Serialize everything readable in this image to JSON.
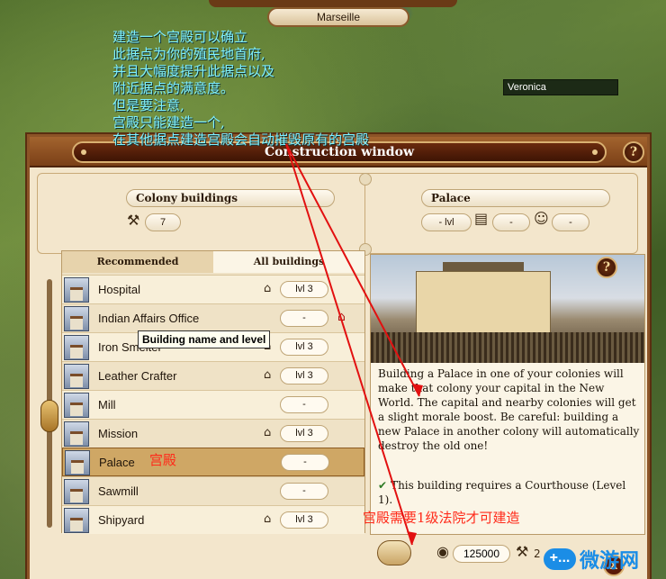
{
  "map": {
    "city_name": "Marseille",
    "player_name": "Veronica"
  },
  "annotations": {
    "note_lines": [
      "建造一个宫殿可以确立",
      "此据点为你的殖民地首府,",
      "并且大幅度提升此据点以及",
      "附近据点的满意度。",
      "但是要注意,",
      "宫殿只能建造一个,",
      "在其他据点建造宫殿会自动摧毁原有的宫殿"
    ],
    "palace_cn": "宫殿",
    "requirement_cn": "宫殿需要1级法院才可建造"
  },
  "window": {
    "title": "Construction window",
    "help": "?",
    "close": "X",
    "colony_buildings_label": "Colony buildings",
    "colony_buildings_count": "7",
    "selected_title": "Palace",
    "selected_level": "- lvl",
    "selected_stat_1": "-",
    "selected_stat_2": "-"
  },
  "tabs": {
    "recommended": "Recommended",
    "all": "All buildings"
  },
  "buildings": [
    {
      "name": "Hospital",
      "level": "lvl 3",
      "icon": "house-icon"
    },
    {
      "name": "Indian Affairs Office",
      "level": "-",
      "icon": "red-building-icon"
    },
    {
      "name": "Iron Smelter",
      "level": "lvl 3",
      "icon": "house-icon"
    },
    {
      "name": "Leather Crafter",
      "level": "lvl 3",
      "icon": "house-icon"
    },
    {
      "name": "Mill",
      "level": "-",
      "icon": ""
    },
    {
      "name": "Mission",
      "level": "lvl 3",
      "icon": "house-icon"
    },
    {
      "name": "Palace",
      "level": "-",
      "icon": ""
    },
    {
      "name": "Sawmill",
      "level": "-",
      "icon": ""
    },
    {
      "name": "Shipyard",
      "level": "lvl 3",
      "icon": "house-icon"
    }
  ],
  "tooltip": "Building name and level",
  "detail": {
    "help": "?",
    "description": "Building a Palace in one of your colonies will make that colony your capital in the New World. The capital and nearby colonies will get a slight morale boost. Be careful: building a new Palace in another colony will automatically destroy the old one!",
    "requirement": "This building requires a Courthouse (Level 1).",
    "cost": "125000",
    "cost_2": "2"
  },
  "watermark": {
    "bubble": "+...",
    "text": "微游网"
  },
  "colors": {
    "window_bg": "#f3e6cc",
    "frame_brown": "#8c5427",
    "annotation_cyan": "#7ff0ff",
    "annotation_red": "#ff2a1a",
    "selected_row": "#cfa765"
  }
}
